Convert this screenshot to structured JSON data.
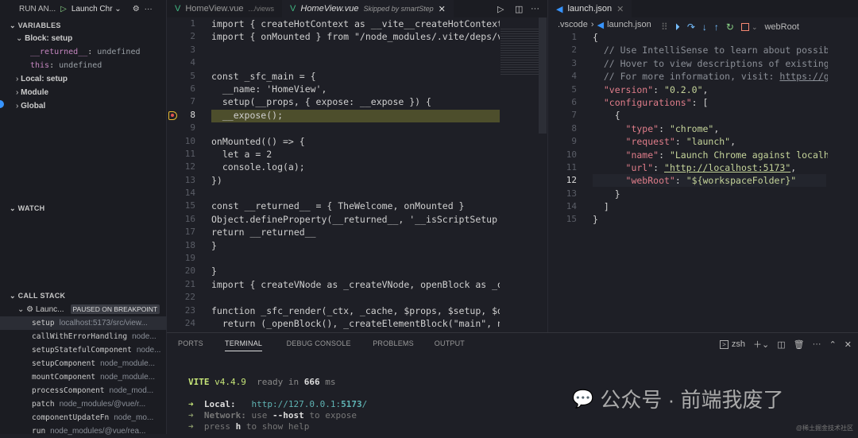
{
  "sidebar": {
    "run_label": "RUN AN...",
    "config": "Launch Chr",
    "variables_header": "VARIABLES",
    "variables": [
      {
        "label": "Block: setup",
        "type": "scope",
        "expanded": true
      },
      {
        "name": "__returned__",
        "value": "undefined",
        "type": "var"
      },
      {
        "name": "this",
        "value": "undefined",
        "type": "var"
      },
      {
        "label": "Local: setup",
        "type": "scope"
      },
      {
        "label": "Module",
        "type": "scope"
      },
      {
        "label": "Global",
        "type": "scope"
      }
    ],
    "watch_header": "WATCH",
    "callstack_header": "CALL STACK",
    "thread": "Launc...",
    "thread_status": "PAUSED ON BREAKPOINT",
    "frames": [
      {
        "fn": "setup",
        "src": "localhost:5173/src/view..."
      },
      {
        "fn": "callWithErrorHandling",
        "src": "node..."
      },
      {
        "fn": "setupStatefulComponent",
        "src": "node..."
      },
      {
        "fn": "setupComponent",
        "src": "node_module..."
      },
      {
        "fn": "mountComponent",
        "src": "node_module..."
      },
      {
        "fn": "processComponent",
        "src": "node_mod..."
      },
      {
        "fn": "patch",
        "src": "node_modules/@vue/r..."
      },
      {
        "fn": "componentUpdateFn",
        "src": "node_mo..."
      },
      {
        "fn": "run",
        "src": "node_modules/@vue/rea..."
      }
    ]
  },
  "editor1": {
    "tabs": [
      {
        "label": "HomeView.vue",
        "desc": ".../views"
      },
      {
        "label": "HomeView.vue",
        "desc": "Skipped by smartStep",
        "active": true
      }
    ],
    "current_line": 8,
    "lines": [
      "import { createHotContext as __vite__createHotContext",
      "import { onMounted } from \"/node_modules/.vite/deps/vue",
      "",
      "",
      "const _sfc_main = {",
      "  __name: 'HomeView',",
      "  setup(__props, { expose: __expose }) {",
      "  __expose();",
      "",
      "onMounted(() => {",
      "  let a = 2",
      "  console.log(a);",
      "})",
      "",
      "const __returned__ = { TheWelcome, onMounted }",
      "Object.defineProperty(__returned__, '__isScriptSetup',",
      "return __returned__",
      "}",
      "",
      "}",
      "import { createVNode as _createVNode, openBlock as _op",
      "",
      "function _sfc_render(_ctx, _cache, $props, $setup, $da",
      "  return (_openBlock(), _createElementBlock(\"main\", nu"
    ]
  },
  "editor2": {
    "tab": "launch.json",
    "breadcrumb": [
      ".vscode",
      "launch.json",
      "webRoot"
    ],
    "current_line": 12,
    "lines": [
      [
        [
          "p",
          "{"
        ]
      ],
      [
        [
          "c",
          "  // Use IntelliSense to learn about possibl"
        ]
      ],
      [
        [
          "c",
          "  // Hover to view descriptions of existing"
        ]
      ],
      [
        [
          "c",
          "  // For more information, visit: "
        ],
        [
          "u",
          "https://go"
        ]
      ],
      [
        [
          "k",
          "  \"version\""
        ],
        [
          "p",
          ": "
        ],
        [
          "s",
          "\"0.2.0\""
        ],
        [
          "p",
          ","
        ]
      ],
      [
        [
          "k",
          "  \"configurations\""
        ],
        [
          "p",
          ": ["
        ]
      ],
      [
        [
          "p",
          "    {"
        ]
      ],
      [
        [
          "k",
          "      \"type\""
        ],
        [
          "p",
          ": "
        ],
        [
          "s",
          "\"chrome\""
        ],
        [
          "p",
          ","
        ]
      ],
      [
        [
          "k",
          "      \"request\""
        ],
        [
          "p",
          ": "
        ],
        [
          "s",
          "\"launch\""
        ],
        [
          "p",
          ","
        ]
      ],
      [
        [
          "k",
          "      \"name\""
        ],
        [
          "p",
          ": "
        ],
        [
          "s",
          "\"Launch Chrome against localho"
        ]
      ],
      [
        [
          "k",
          "      \"url\""
        ],
        [
          "p",
          ": "
        ],
        [
          "su",
          "\"http://localhost:5173\""
        ],
        [
          "p",
          ","
        ]
      ],
      [
        [
          "k",
          "      \"webRoot\""
        ],
        [
          "p",
          ": "
        ],
        [
          "s",
          "\"${workspaceFolder}\""
        ]
      ],
      [
        [
          "p",
          "    }"
        ]
      ],
      [
        [
          "p",
          "  ]"
        ]
      ],
      [
        [
          "p",
          "}"
        ]
      ]
    ]
  },
  "panel": {
    "tabs": [
      "PORTS",
      "TERMINAL",
      "DEBUG CONSOLE",
      "PROBLEMS",
      "OUTPUT"
    ],
    "active_tab": "TERMINAL",
    "shell": "zsh",
    "terminal": {
      "vite": "VITE",
      "version": "v4.4.9",
      "ready": "ready in",
      "ms_value": "666",
      "ms": "ms",
      "local_label": "Local:",
      "local_url_a": "http://127.0.0.1:",
      "local_port": "5173",
      "local_url_b": "/",
      "network_label": "Network:",
      "network_a": "use",
      "network_flag": "--host",
      "network_b": "to expose",
      "help_a": "press",
      "help_key": "h",
      "help_b": "to show help"
    }
  },
  "watermark": {
    "text": "公众号 · 前端我废了",
    "small": "@稀土掘金技术社区"
  },
  "colors": {
    "accent": "#3794ff",
    "highlight": "#4d4e2c",
    "breakpoint": "#e8b931"
  }
}
